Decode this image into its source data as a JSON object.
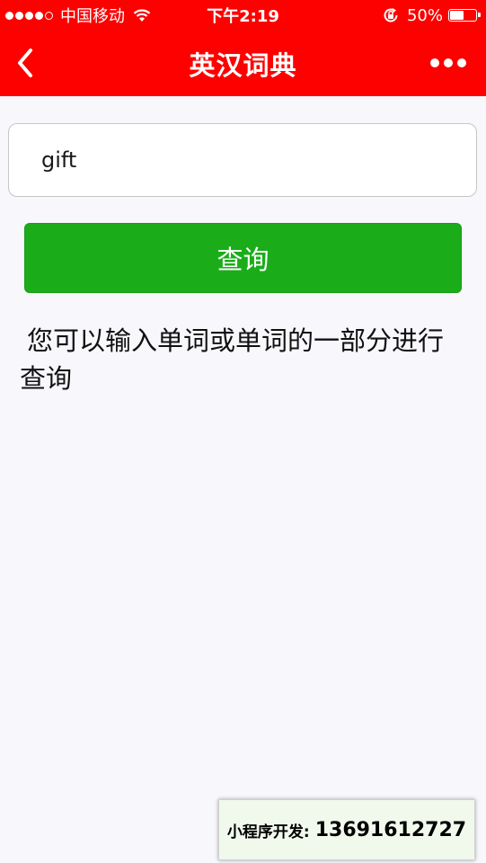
{
  "status_bar": {
    "carrier": "中国移动",
    "time": "下午2:19",
    "battery_percent": "50%",
    "battery_level": 0.5,
    "signal_icon": "signal-dots-icon",
    "wifi_icon": "wifi-icon",
    "rotation_lock_icon": "rotation-lock-icon"
  },
  "nav": {
    "title": "英汉词典",
    "back_icon": "chevron-left-icon",
    "more_icon": "more-dots-icon"
  },
  "search": {
    "value": "gift",
    "placeholder": ""
  },
  "query_button": {
    "label": "查询"
  },
  "hint": {
    "text": "您可以输入单词或单词的一部分进行查询"
  },
  "promo": {
    "label": "小程序开发:",
    "phone": "13691612727"
  },
  "colors": {
    "header_red": "#fd0000",
    "button_green": "#1aad19",
    "background": "#f8f7fc"
  }
}
